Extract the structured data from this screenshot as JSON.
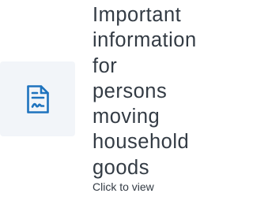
{
  "card": {
    "icon": "signed-document-icon",
    "title": "Important information for persons moving household goods",
    "cta": "Click to view",
    "colors": {
      "icon_accent": "#1e73be",
      "tile_background": "#f2f5f9",
      "text": "#333b44"
    }
  }
}
